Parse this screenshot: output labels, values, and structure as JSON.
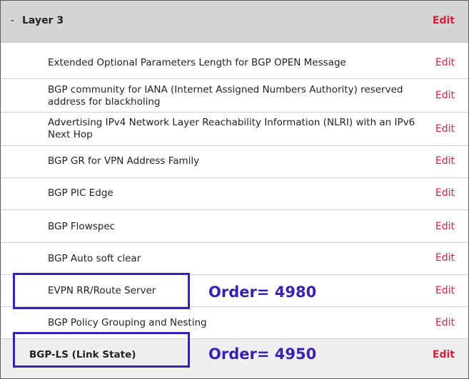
{
  "section": {
    "collapse_symbol": "-",
    "title": "Layer 3",
    "edit_label": "Edit"
  },
  "rows": [
    {
      "label": "Extended Optional Parameters Length for BGP OPEN Message",
      "edit_label": "Edit"
    },
    {
      "label": "BGP community for IANA (Internet Assigned Numbers Authority) reserved address for blackholing",
      "edit_label": "Edit"
    },
    {
      "label": "Advertising IPv4 Network Layer Reachability Information (NLRI) with an IPv6 Next Hop",
      "edit_label": "Edit"
    },
    {
      "label": "BGP GR for VPN Address Family",
      "edit_label": "Edit"
    },
    {
      "label": "BGP PIC Edge",
      "edit_label": "Edit"
    },
    {
      "label": "BGP Flowspec",
      "edit_label": "Edit"
    },
    {
      "label": "BGP Auto soft clear",
      "edit_label": "Edit"
    },
    {
      "label": "EVPN RR/Route Server",
      "edit_label": "Edit"
    },
    {
      "label": "BGP Policy Grouping and Nesting",
      "edit_label": "Edit"
    },
    {
      "label": "BGP-LS (Link State)",
      "edit_label": "Edit"
    }
  ],
  "annotations": {
    "evpn_order": "Order= 4980",
    "bgpls_order": "Order= 4950",
    "color": "#3b1fb0"
  },
  "colors": {
    "edit": "#d81e3c",
    "header_bg": "#d4d4d4"
  }
}
